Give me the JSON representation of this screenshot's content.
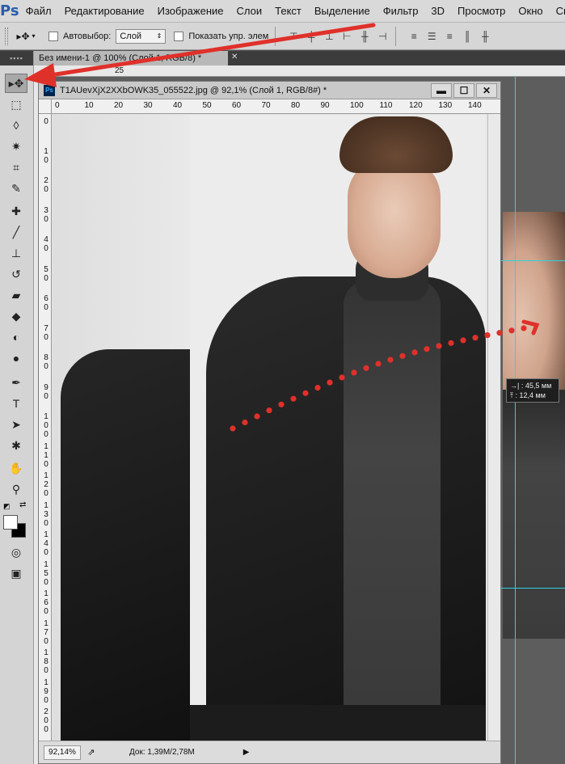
{
  "app": {
    "logo": "Ps"
  },
  "menu": [
    "Файл",
    "Редактирование",
    "Изображение",
    "Слои",
    "Текст",
    "Выделение",
    "Фильтр",
    "3D",
    "Просмотр",
    "Окно",
    "Спр"
  ],
  "options": {
    "autoselect_label": "Автовыбор:",
    "autoselect_value": "Слой",
    "show_controls_label": "Показать упр. элем"
  },
  "tabs": {
    "back_doc": "Без имени-1 @ 100% (Слой 1, RGB/8) *"
  },
  "toolbar": {
    "tools": [
      "move",
      "marquee",
      "lasso",
      "magic-wand",
      "crop",
      "eyedropper",
      "healing",
      "brush",
      "stamp",
      "history-brush",
      "eraser",
      "gradient",
      "blur",
      "dodge",
      "pen",
      "type",
      "path-select",
      "shape",
      "hand",
      "zoom",
      "colors",
      "quick-mask",
      "screen-mode"
    ]
  },
  "back_ruler": {
    "tick": "25"
  },
  "document": {
    "title": "T1AUevXjX2XXbOWK35_055522.jpg @ 92,1% (Слой 1, RGB/8#) *",
    "buttons": {
      "minimize": "▬",
      "maximize": "☐",
      "close": "✕"
    },
    "ruler_top": [
      "0",
      "10",
      "20",
      "30",
      "40",
      "50",
      "60",
      "70",
      "80",
      "90",
      "100",
      "110",
      "120",
      "130",
      "140"
    ],
    "ruler_left": [
      "0",
      "10",
      "20",
      "30",
      "40",
      "50",
      "60",
      "70",
      "80",
      "90",
      "100",
      "110",
      "120",
      "130",
      "140",
      "150",
      "160",
      "170",
      "180",
      "190",
      "200"
    ],
    "status": {
      "zoom": "92,14%",
      "doc_info": "Док: 1,39M/2,78M"
    }
  },
  "measurement": {
    "x": "45,5 мм",
    "y": "12,4 мм"
  },
  "colors": {
    "annotation_red": "#e0302a",
    "guide": "#2fd1e0"
  }
}
